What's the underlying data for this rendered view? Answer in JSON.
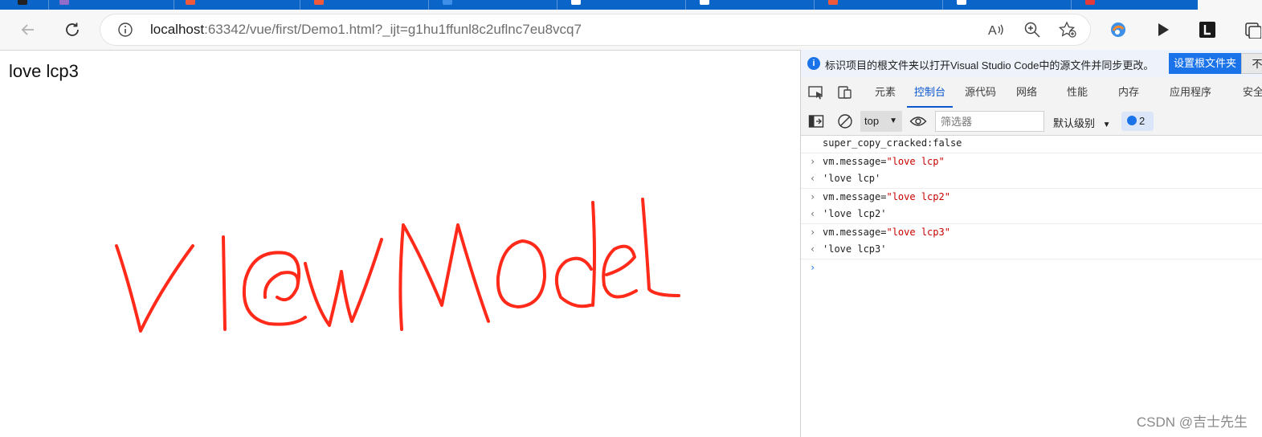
{
  "browser": {
    "url_host": "localhost",
    "url_rest": ":63342/vue/first/Demo1.html?_ijt=g1hu1ffunl8c2uflnc7eu8vcq7",
    "tab_favicon_colors": [
      "#8e6cc8",
      "#f05a3a",
      "#f05a3a",
      "#3d8fe8",
      "#ffffff",
      "#ffffff",
      "#f05a3a",
      "#ffffff",
      "#e23a3a",
      "#e23a3a"
    ],
    "accent": "#0b64c7"
  },
  "page": {
    "message": "love lcp3",
    "drawing_text": "ViewModel",
    "drawing_color": "#ff2a1a"
  },
  "devtools": {
    "infobar": {
      "message": "标识项目的根文件夹以打开Visual Studio Code中的源文件并同步更改。",
      "primary_button": "设置根文件夹",
      "secondary_button": "不"
    },
    "tabs": [
      "元素",
      "控制台",
      "源代码",
      "网络",
      "性能",
      "内存",
      "应用程序",
      "安全"
    ],
    "active_tab": "控制台",
    "console_toolbar": {
      "context": "top",
      "filter_placeholder": "筛选器",
      "levels": "默认级别",
      "issues_count": "2"
    },
    "console_lines": [
      {
        "kind": "log",
        "text": "super_copy_cracked:false"
      },
      {
        "kind": "input",
        "code": "vm.message=",
        "string": "\"love lcp\""
      },
      {
        "kind": "output",
        "string": "'love lcp'"
      },
      {
        "kind": "input",
        "code": "vm.message=",
        "string": "\"love lcp2\""
      },
      {
        "kind": "output",
        "string": "'love lcp2'"
      },
      {
        "kind": "input",
        "code": "vm.message=",
        "string": "\"love lcp3\""
      },
      {
        "kind": "output",
        "string": "'love lcp3'"
      }
    ]
  },
  "watermark": "CSDN @吉士先生"
}
